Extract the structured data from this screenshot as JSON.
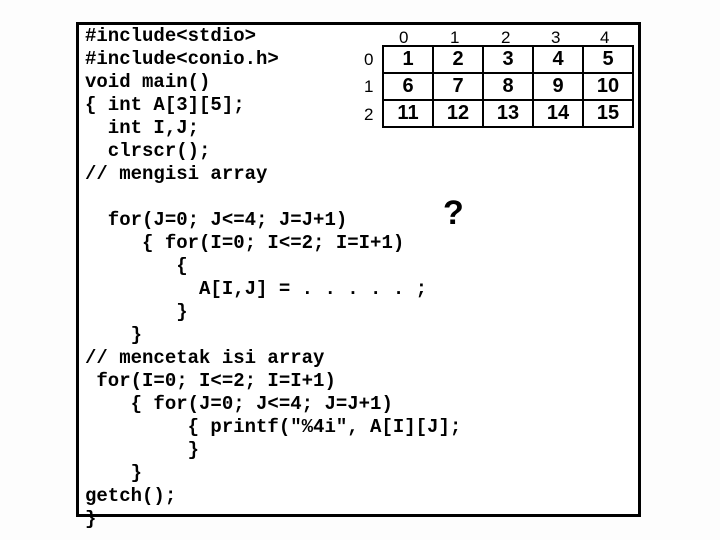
{
  "code": {
    "l1": "#include<stdio>",
    "l2": "#include<conio.h>",
    "l3": "void main()",
    "l4": "{ int A[3][5];",
    "l5": "  int I,J;",
    "l6": "  clrscr();",
    "l7": "// mengisi array",
    "l8": "",
    "l9": "  for(J=0; J<=4; J=J+1)",
    "l10": "     { for(I=0; I<=2; I=I+1)",
    "l11": "        {",
    "l12": "          A[I,J] = . . . . . ;",
    "l13": "        }",
    "l14": "    }",
    "l15": "// mencetak isi array",
    "l16": " for(I=0; I<=2; I=I+1)",
    "l17": "    { for(J=0; J<=4; J=J+1)",
    "l18": "         { printf(\"%4i\", A[I][J];",
    "l19": "         }",
    "l20": "    }",
    "l21": "getch();",
    "l22": "}"
  },
  "qmark": "?",
  "table": {
    "col_headers": [
      "0",
      "1",
      "2",
      "3",
      "4"
    ],
    "row_headers": [
      "0",
      "1",
      "2"
    ],
    "rows": [
      [
        "1",
        "2",
        "3",
        "4",
        "5"
      ],
      [
        "6",
        "7",
        "8",
        "9",
        "10"
      ],
      [
        "11",
        "12",
        "13",
        "14",
        "15"
      ]
    ]
  }
}
